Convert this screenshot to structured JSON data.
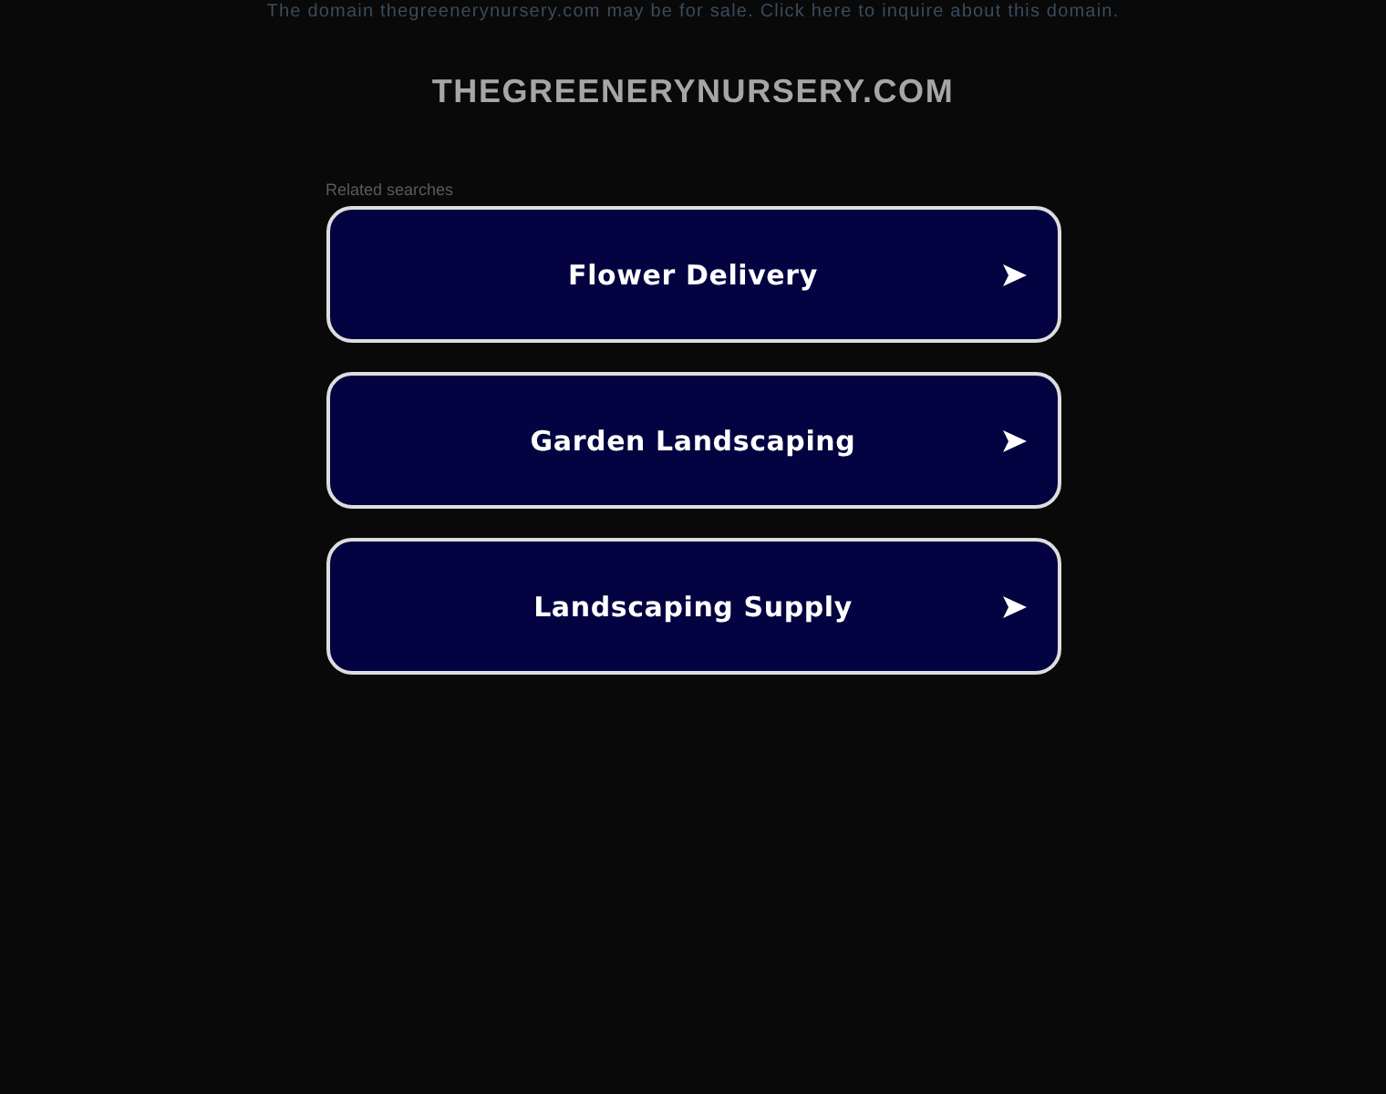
{
  "sale_notice": "The domain thegreenerynursery.com may be for sale. Click here to inquire about this domain.",
  "domain_title": "THEGREENERYNURSERY.COM",
  "related": {
    "heading": "Related searches",
    "links": [
      {
        "label": "Flower Delivery"
      },
      {
        "label": "Garden Landscaping"
      },
      {
        "label": "Landscaping Supply"
      }
    ]
  }
}
